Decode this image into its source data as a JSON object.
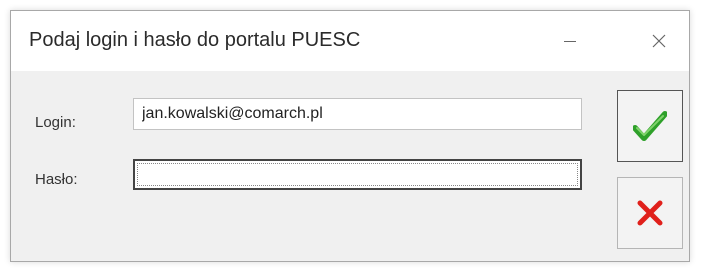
{
  "window": {
    "title": "Podaj login i hasło do portalu PUESC"
  },
  "form": {
    "login_label": "Login:",
    "login_value": "jan.kowalski@comarch.pl",
    "password_label": "Hasło:",
    "password_value": ""
  },
  "buttons": {
    "ok_icon": "green-checkmark-icon",
    "cancel_icon": "red-x-icon"
  },
  "colors": {
    "ok": "#2ea02a",
    "cancel": "#e0201b"
  }
}
